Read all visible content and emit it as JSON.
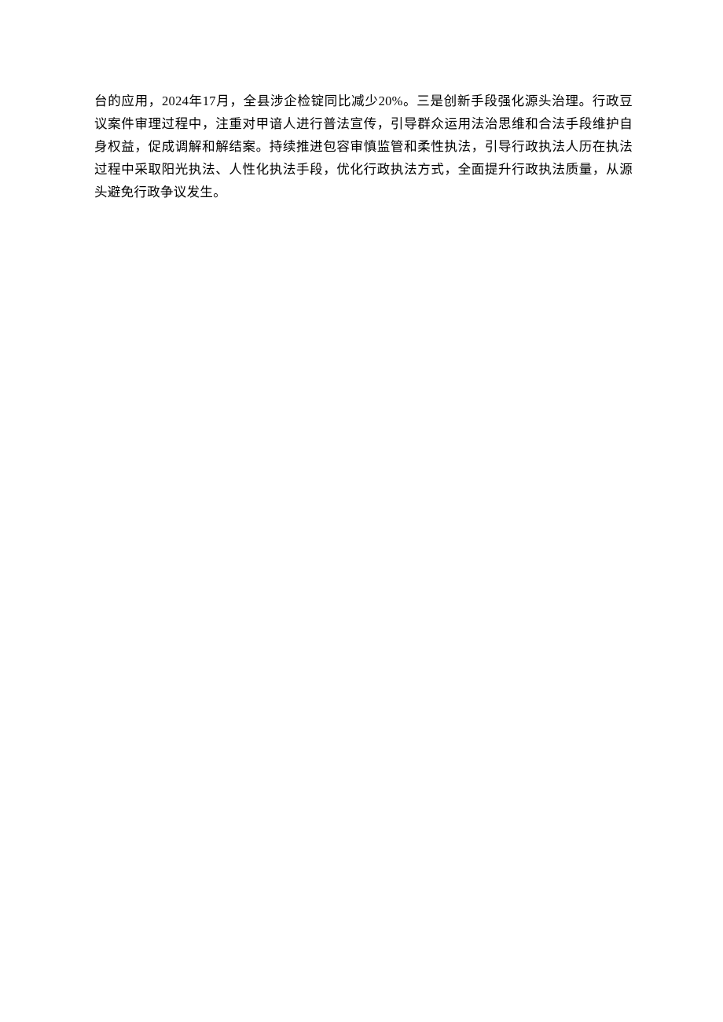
{
  "document": {
    "paragraph": "台的应用，2024年17月，全县涉企检锭同比减少20%。三是创新手段强化源头治理。行政豆议案件审理过程中，注重对甲谙人进行普法宣传，引导群众运用法治思维和合法手段维护自身权益，促成调解和解结案。持续推进包容审慎监管和柔性执法，引导行政执法人历在执法过程中采取阳光执法、人性化执法手段，优化行政执法方式，全面提升行政执法质量，从源头避免行政争议发生。"
  }
}
